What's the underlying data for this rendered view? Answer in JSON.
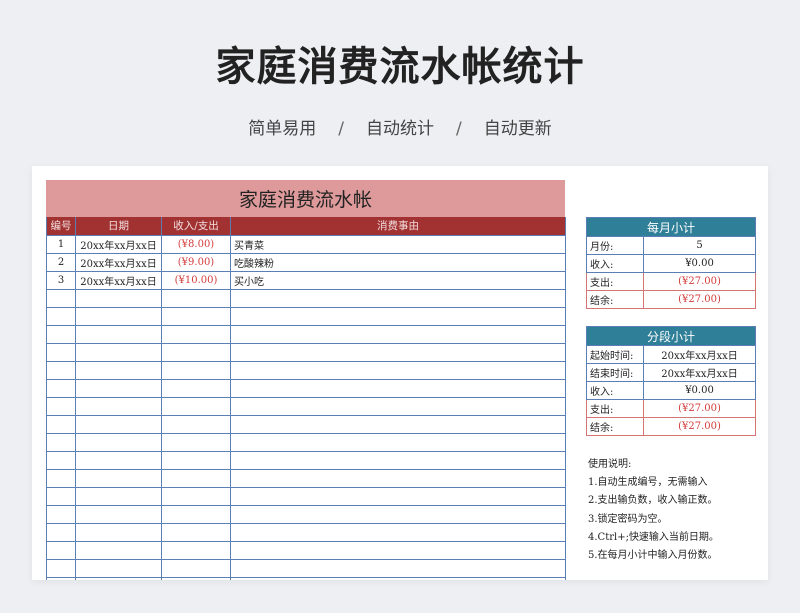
{
  "hero": {
    "title": "家庭消费流水帐统计",
    "tags": [
      "简单易用",
      "自动统计",
      "自动更新"
    ],
    "separator": "/"
  },
  "ledger": {
    "title": "家庭消费流水帐",
    "headers": [
      "编号",
      "日期",
      "收入/支出",
      "消费事由"
    ],
    "rows": [
      {
        "no": "1",
        "date": "20xx年xx月xx日",
        "amount": "(¥8.00)",
        "reason": "买青菜"
      },
      {
        "no": "2",
        "date": "20xx年xx月xx日",
        "amount": "(¥9.00)",
        "reason": "吃酸辣粉"
      },
      {
        "no": "3",
        "date": "20xx年xx月xx日",
        "amount": "(¥10.00)",
        "reason": "买小吃"
      }
    ],
    "empty_rows": 17
  },
  "monthly": {
    "title": "每月小计",
    "rows": [
      {
        "label": "月份:",
        "value": "5"
      },
      {
        "label": "收入:",
        "value": "¥0.00"
      },
      {
        "label": "支出:",
        "value": "(¥27.00)"
      },
      {
        "label": "结余:",
        "value": "(¥27.00)"
      }
    ]
  },
  "segment": {
    "title": "分段小计",
    "rows": [
      {
        "label": "起始时间:",
        "value": "20xx年xx月xx日"
      },
      {
        "label": "结束时间:",
        "value": "20xx年xx月xx日"
      },
      {
        "label": "收入:",
        "value": "¥0.00"
      },
      {
        "label": "支出:",
        "value": "(¥27.00)"
      },
      {
        "label": "结余:",
        "value": "(¥27.00)"
      }
    ]
  },
  "notes": {
    "title": "使用说明:",
    "items": [
      "1.自动生成编号，无需输入",
      "2.支出输负数，收入输正数。",
      "3.锁定密码为空。",
      "4.Ctrl+;快速输入当前日期。",
      "5.在每月小计中输入月份数。"
    ]
  },
  "colors": {
    "ledger_title_bg": "#de9a9b",
    "ledger_header_bg": "#a23232",
    "panel_header_bg": "#2e7f97",
    "grid_blue": "#5b7fb5",
    "negative_red": "#d23a3a"
  }
}
